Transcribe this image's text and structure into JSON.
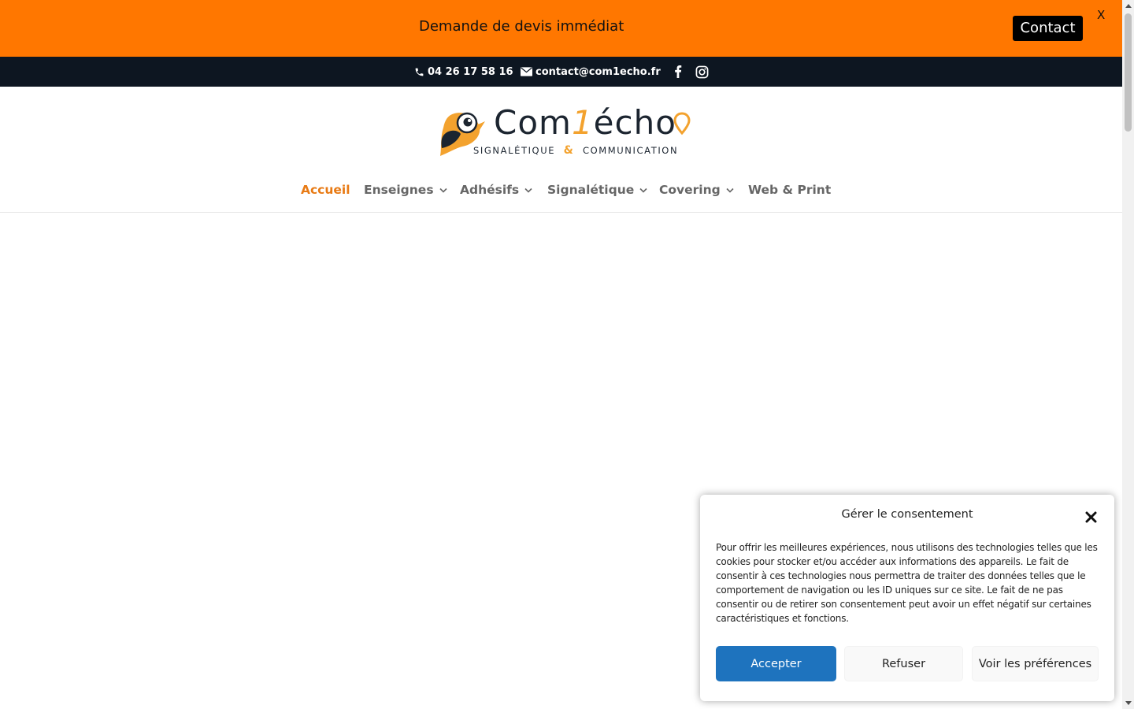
{
  "promo": {
    "text": "Demande de devis immédiat",
    "contact_label": "Contact",
    "close_label": "X",
    "background": "#ff7700"
  },
  "topbar": {
    "phone": "04 26 17 58 16",
    "email": "contact@com1echo.fr",
    "phone_icon": "phone-icon",
    "email_icon": "envelope-icon",
    "social_icons": [
      "facebook-icon",
      "instagram-icon"
    ],
    "background": "#0d1621"
  },
  "logo": {
    "word_start": "Com",
    "word_one": "1",
    "word_end": "écho",
    "tagline_left": "SIGNALÉTIQUE",
    "tagline_amp": "&",
    "tagline_right": "COMMUNICATION",
    "accent": "#f3a22e",
    "dark": "#1c2530"
  },
  "nav": {
    "items": [
      {
        "label": "Accueil",
        "active": true,
        "has_dropdown": false
      },
      {
        "label": "Enseignes",
        "active": false,
        "has_dropdown": true
      },
      {
        "label": "Adhésifs",
        "active": false,
        "has_dropdown": true
      },
      {
        "label": "Signalétique",
        "active": false,
        "has_dropdown": true
      },
      {
        "label": "Covering",
        "active": false,
        "has_dropdown": true
      },
      {
        "label": "Web & Print",
        "active": false,
        "has_dropdown": false
      }
    ],
    "active_color": "#e87a14",
    "color": "#666666"
  },
  "consent": {
    "title": "Gérer le consentement",
    "body": "Pour offrir les meilleures expériences, nous utilisons des technologies telles que les cookies pour stocker et/ou accéder aux informations des appareils. Le fait de consentir à ces technologies nous permettra de traiter des données telles que le comportement de navigation ou les ID uniques sur ce site. Le fait de ne pas consentir ou de retirer son consentement peut avoir un effet négatif sur certaines caractéristiques et fonctions.",
    "accept_label": "Accepter",
    "refuse_label": "Refuser",
    "prefs_label": "Voir les préférences",
    "accept_color": "#1e73be"
  }
}
